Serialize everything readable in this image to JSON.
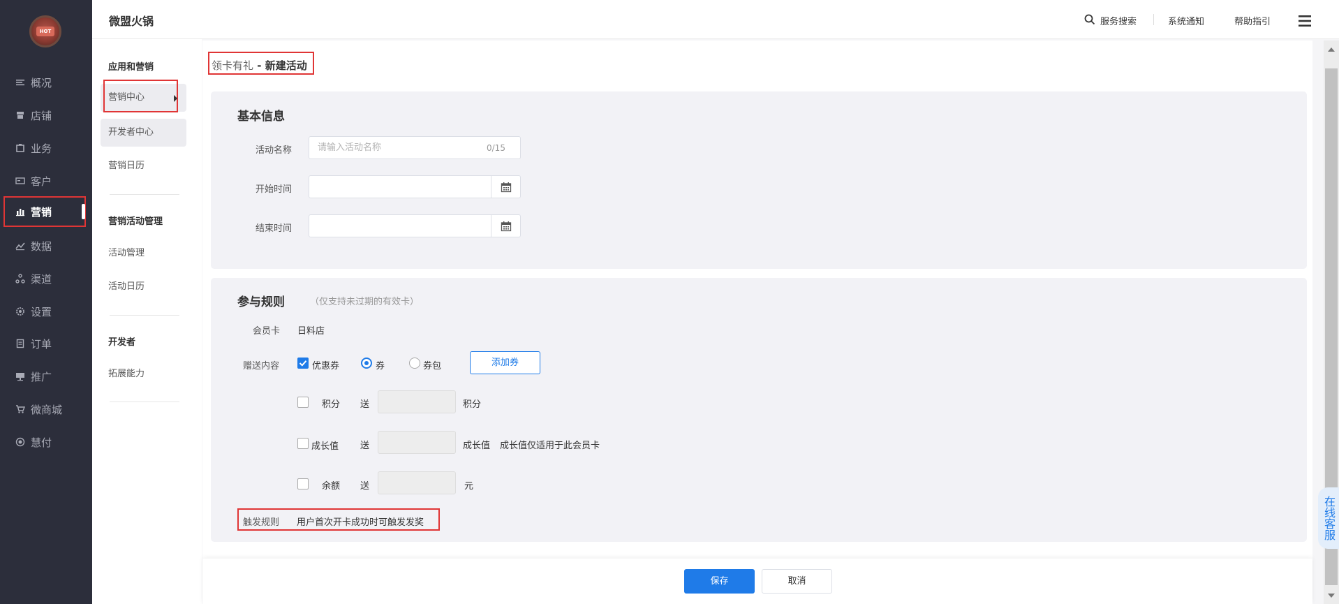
{
  "app": {
    "brand": "微盟火锅",
    "logo_text": "HOT"
  },
  "header": {
    "search": "服务搜索",
    "notify": "系统通知",
    "help": "帮助指引"
  },
  "nav": [
    {
      "label": "概况",
      "icon": "overview-icon"
    },
    {
      "label": "店铺",
      "icon": "store-icon"
    },
    {
      "label": "业务",
      "icon": "business-icon"
    },
    {
      "label": "客户",
      "icon": "customer-icon"
    },
    {
      "label": "营销",
      "icon": "marketing-icon",
      "active": true
    },
    {
      "label": "数据",
      "icon": "data-icon"
    },
    {
      "label": "渠道",
      "icon": "channel-icon"
    },
    {
      "label": "设置",
      "icon": "settings-icon"
    },
    {
      "label": "订单",
      "icon": "order-icon"
    },
    {
      "label": "推广",
      "icon": "promotion-icon"
    },
    {
      "label": "微商城",
      "icon": "mall-icon"
    },
    {
      "label": "慧付",
      "icon": "pay-icon"
    }
  ],
  "subnav": {
    "group1": {
      "title": "应用和营销",
      "items": [
        "营销中心",
        "开发者中心",
        "营销日历"
      ]
    },
    "group2": {
      "title": "营销活动管理",
      "items": [
        "活动管理",
        "活动日历"
      ]
    },
    "group3": {
      "title": "开发者",
      "items": [
        "拓展能力"
      ]
    }
  },
  "breadcrumb": {
    "parent": "领卡有礼",
    "separator": " - ",
    "current": "新建活动"
  },
  "basic": {
    "title": "基本信息",
    "name_label": "活动名称",
    "name_placeholder": "请输入活动名称",
    "name_count": "0/15",
    "start_label": "开始时间",
    "end_label": "结束时间"
  },
  "rules": {
    "title": "参与规则",
    "note": "（仅支持未过期的有效卡）",
    "card_label": "会员卡",
    "card_value": "日料店",
    "gift_label": "赠送内容",
    "coupon_label": "优惠券",
    "coupon_checked": true,
    "radio_coupon": "券",
    "radio_pack": "券包",
    "add_coupon": "添加券",
    "points_label": "积分",
    "give": "送",
    "points_unit": "积分",
    "growth_label": "成长值",
    "growth_unit": "成长值",
    "growth_note": "成长值仅适用于此会员卡",
    "balance_label": "余额",
    "balance_unit": "元",
    "trigger_label": "触发规则",
    "trigger_value": "用户首次开卡成功时可触发发奖"
  },
  "footer": {
    "save": "保存",
    "cancel": "取消"
  },
  "service": "在线客服",
  "colors": {
    "primary": "#1f7be8",
    "sidebar": "#2c2e3b",
    "highlight": "#e03535"
  }
}
